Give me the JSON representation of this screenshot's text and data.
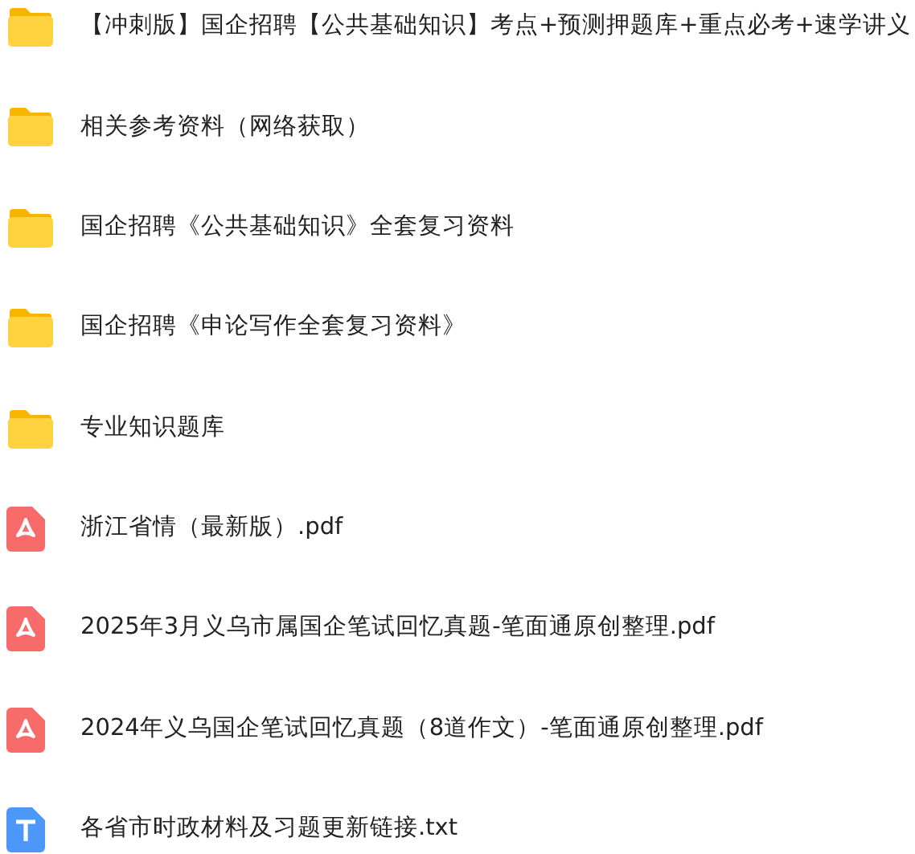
{
  "files": [
    {
      "kind": "folder",
      "name": "【冲刺版】国企招聘【公共基础知识】考点+预测押题库+重点必考+速学讲义"
    },
    {
      "kind": "folder",
      "name": "相关参考资料（网络获取）"
    },
    {
      "kind": "folder",
      "name": "国企招聘《公共基础知识》全套复习资料"
    },
    {
      "kind": "folder",
      "name": "国企招聘《申论写作全套复习资料》"
    },
    {
      "kind": "folder",
      "name": "专业知识题库"
    },
    {
      "kind": "pdf",
      "name": "浙江省情（最新版）.pdf"
    },
    {
      "kind": "pdf",
      "name": "2025年3月义乌市属国企笔试回忆真题-笔面通原创整理.pdf"
    },
    {
      "kind": "pdf",
      "name": "2024年义乌国企笔试回忆真题（8道作文）-笔面通原创整理.pdf"
    },
    {
      "kind": "txt",
      "name": "各省市时政材料及习题更新链接.txt"
    }
  ]
}
